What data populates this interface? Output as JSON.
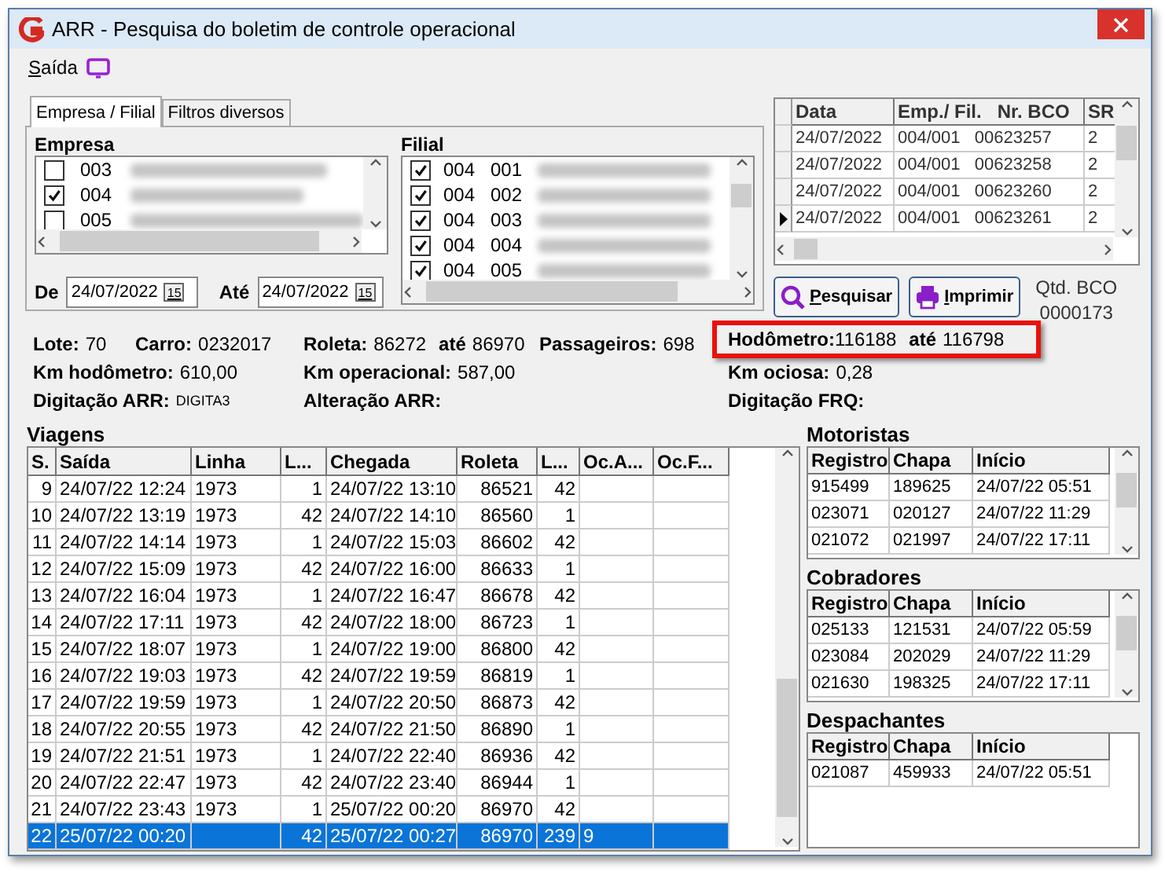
{
  "window": {
    "title": "ARR - Pesquisa do boletim de controle operacional"
  },
  "menu": [
    {
      "label": "Saída"
    }
  ],
  "tabs": [
    {
      "label": "Empresa / Filial",
      "selected": true
    },
    {
      "label": "Filtros diversos",
      "selected": false
    }
  ],
  "empresa": {
    "label": "Empresa",
    "items": [
      {
        "code": "003",
        "checked": false
      },
      {
        "code": "004",
        "checked": true
      },
      {
        "code": "005",
        "checked": false
      }
    ]
  },
  "filial": {
    "label": "Filial",
    "items": [
      {
        "code": "004",
        "branch": "001",
        "checked": true
      },
      {
        "code": "004",
        "branch": "002",
        "checked": true
      },
      {
        "code": "004",
        "branch": "003",
        "checked": true
      },
      {
        "code": "004",
        "branch": "004",
        "checked": true
      },
      {
        "code": "004",
        "branch": "005",
        "checked": true
      }
    ]
  },
  "dates": [
    {
      "label": "De",
      "value": "24/07/2022",
      "calendar_label": "15"
    },
    {
      "label": "Até",
      "value": "24/07/2022",
      "calendar_label": "15"
    }
  ],
  "bco_grid": {
    "columns": [
      "Data",
      "Emp./ Fil.   Nr. BCO",
      "SR"
    ],
    "rows": [
      {
        "cells": [
          "24/07/2022",
          "004/001   00623257",
          "2"
        ],
        "current": false
      },
      {
        "cells": [
          "24/07/2022",
          "004/001   00623258",
          "2"
        ],
        "current": false
      },
      {
        "cells": [
          "24/07/2022",
          "004/001   00623260",
          "2"
        ],
        "current": false
      },
      {
        "cells": [
          "24/07/2022",
          "004/001   00623261",
          "2"
        ],
        "current": true
      }
    ]
  },
  "buttons": [
    {
      "label": "Pesquisar",
      "kind": "search"
    },
    {
      "label": "Imprimir",
      "kind": "print"
    }
  ],
  "qtd_bco": {
    "label": "Qtd. BCO",
    "value": "0000173"
  },
  "info": [
    [
      {
        "pairs": [
          {
            "label": "Lote:",
            "value": "70"
          }
        ],
        "highlighted": false
      },
      {
        "pairs": [
          {
            "label": "Carro:",
            "value": "0232017"
          }
        ],
        "highlighted": false
      },
      {
        "pairs": [
          {
            "label": "Roleta:",
            "value": "86272"
          },
          {
            "label": "até",
            "value": "86970"
          }
        ],
        "highlighted": false
      },
      {
        "pairs": [
          {
            "label": "Passageiros:",
            "value": "698"
          }
        ],
        "highlighted": false
      },
      {
        "pairs": [
          {
            "label": "Hodômetro:",
            "value": "116188"
          },
          {
            "label": "até",
            "value": "116798"
          }
        ],
        "highlighted": true
      }
    ],
    [
      {
        "pairs": [
          {
            "label": "Km hodômetro:",
            "value": "610,00"
          }
        ],
        "highlighted": false
      },
      {
        "pairs": [
          {
            "label": "Km operacional:",
            "value": "587,00"
          }
        ],
        "highlighted": false
      },
      {
        "pairs": [
          {
            "label": "Km ociosa:",
            "value": "0,28"
          }
        ],
        "highlighted": false
      }
    ],
    [
      {
        "pairs": [
          {
            "label": "Digitação ARR:",
            "value": "DIGITA3",
            "small": true
          }
        ],
        "highlighted": false
      },
      {
        "pairs": [
          {
            "label": "Alteração ARR:"
          }
        ],
        "highlighted": false
      },
      {
        "pairs": [
          {
            "label": "Digitação FRQ:"
          }
        ],
        "highlighted": false
      }
    ]
  ],
  "viagens": {
    "title": "Viagens",
    "columns": [
      "S.",
      "Saída",
      "Linha",
      "L...",
      "Chegada",
      "Roleta",
      "L...",
      "Oc.A...",
      "Oc.F..."
    ],
    "rows": [
      {
        "cells": [
          "9",
          "24/07/22 12:24",
          "1973",
          "1",
          "24/07/22 13:10",
          "86521",
          "42",
          null,
          null
        ],
        "selected": false
      },
      {
        "cells": [
          "10",
          "24/07/22 13:19",
          "1973",
          "42",
          "24/07/22 14:10",
          "86560",
          "1",
          null,
          null
        ],
        "selected": false
      },
      {
        "cells": [
          "11",
          "24/07/22 14:14",
          "1973",
          "1",
          "24/07/22 15:03",
          "86602",
          "42",
          null,
          null
        ],
        "selected": false
      },
      {
        "cells": [
          "12",
          "24/07/22 15:09",
          "1973",
          "42",
          "24/07/22 16:00",
          "86633",
          "1",
          null,
          null
        ],
        "selected": false
      },
      {
        "cells": [
          "13",
          "24/07/22 16:04",
          "1973",
          "1",
          "24/07/22 16:47",
          "86678",
          "42",
          null,
          null
        ],
        "selected": false
      },
      {
        "cells": [
          "14",
          "24/07/22 17:11",
          "1973",
          "42",
          "24/07/22 18:00",
          "86723",
          "1",
          null,
          null
        ],
        "selected": false
      },
      {
        "cells": [
          "15",
          "24/07/22 18:07",
          "1973",
          "1",
          "24/07/22 19:00",
          "86800",
          "42",
          null,
          null
        ],
        "selected": false
      },
      {
        "cells": [
          "16",
          "24/07/22 19:03",
          "1973",
          "42",
          "24/07/22 19:59",
          "86819",
          "1",
          null,
          null
        ],
        "selected": false
      },
      {
        "cells": [
          "17",
          "24/07/22 19:59",
          "1973",
          "1",
          "24/07/22 20:50",
          "86873",
          "42",
          null,
          null
        ],
        "selected": false
      },
      {
        "cells": [
          "18",
          "24/07/22 20:55",
          "1973",
          "42",
          "24/07/22 21:50",
          "86890",
          "1",
          null,
          null
        ],
        "selected": false
      },
      {
        "cells": [
          "19",
          "24/07/22 21:51",
          "1973",
          "1",
          "24/07/22 22:40",
          "86936",
          "42",
          null,
          null
        ],
        "selected": false
      },
      {
        "cells": [
          "20",
          "24/07/22 22:47",
          "1973",
          "42",
          "24/07/22 23:40",
          "86944",
          "1",
          null,
          null
        ],
        "selected": false
      },
      {
        "cells": [
          "21",
          "24/07/22 23:43",
          "1973",
          "1",
          "25/07/22 00:20",
          "86970",
          "42",
          null,
          null
        ],
        "selected": false
      },
      {
        "cells": [
          "22",
          "25/07/22 00:20",
          null,
          "42",
          "25/07/22 00:27",
          "86970",
          "239",
          "9",
          null
        ],
        "selected": true
      }
    ]
  },
  "staff": [
    {
      "title": "Motoristas",
      "columns": [
        "Registro",
        "Chapa",
        "Início"
      ],
      "rows": [
        [
          "915499",
          "189625",
          "24/07/22 05:51"
        ],
        [
          "023071",
          "020127",
          "24/07/22 11:29"
        ],
        [
          "021072",
          "021997",
          "24/07/22 17:11"
        ]
      ],
      "scroll": true
    },
    {
      "title": "Cobradores",
      "columns": [
        "Registro",
        "Chapa",
        "Início"
      ],
      "rows": [
        [
          "025133",
          "121531",
          "24/07/22 05:59"
        ],
        [
          "023084",
          "202029",
          "24/07/22 11:29"
        ],
        [
          "021630",
          "198325",
          "24/07/22 17:11"
        ]
      ],
      "scroll": true
    },
    {
      "title": "Despachantes",
      "columns": [
        "Registro",
        "Chapa",
        "Início"
      ],
      "rows": [
        [
          "021087",
          "459933",
          "24/07/22 05:51"
        ]
      ],
      "scroll": false
    }
  ]
}
